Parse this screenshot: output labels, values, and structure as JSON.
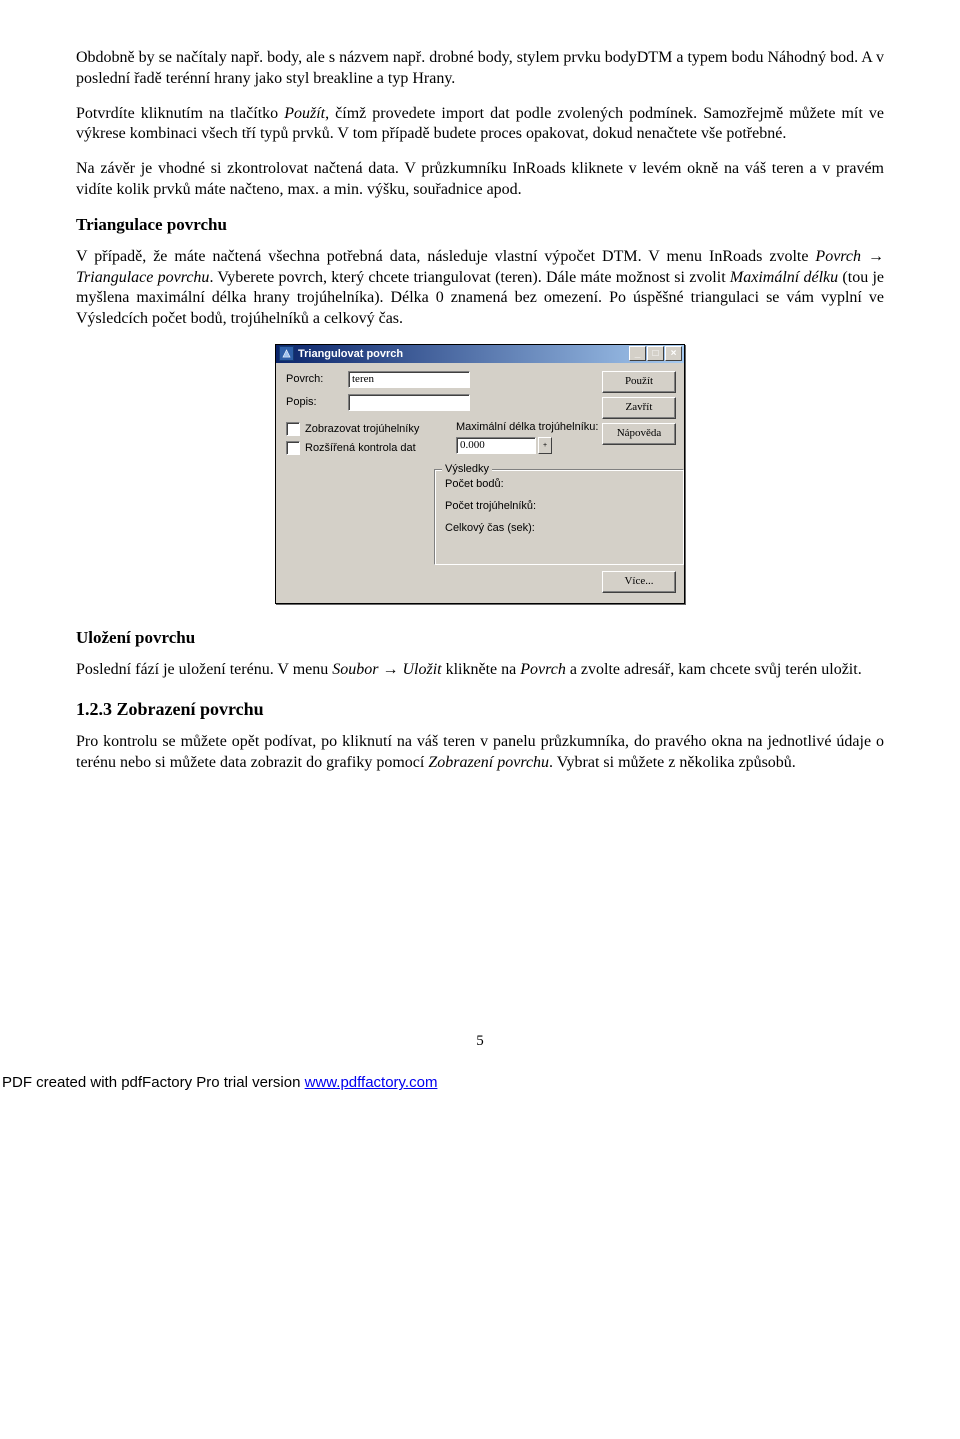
{
  "para1_a": "Obdobně by se načítaly např. body, ale s názvem např. drobné body, stylem prvku bodyDTM a typem bodu Náhodný bod. A v poslední řadě terénní hrany jako styl breakline a typ Hrany.",
  "para2_a": "Potvrdíte kliknutím na tlačítko ",
  "para2_i": "Použít",
  "para2_b": ", čímž provedete import dat podle zvolených podmínek. Samozřejmě můžete mít ve výkrese kombinaci všech tří typů prvků. V tom případě budete proces opakovat, dokud nenačtete vše potřebné.",
  "para3": "Na závěr je vhodné si zkontrolovat načtená data. V průzkumníku InRoads kliknete v levém okně na váš teren a v pravém vidíte kolik prvků máte načteno, max. a min. výšku, souřadnice apod.",
  "h_triang": "Triangulace povrchu",
  "para4_a": "V případě, že máte načtená všechna potřebná data, následuje vlastní výpočet DTM. V menu InRoads zvolte ",
  "para4_i1": "Povrch → Triangulace povrchu",
  "para4_b": ". Vyberete povrch, který chcete triangulovat (teren). Dále máte možnost si zvolit ",
  "para4_i2": "Maximální délku",
  "para4_c": " (tou je myšlena maximální délka hrany trojúhelníka). Délka 0 znamená bez omezení. Po úspěšné triangulaci se vám vyplní ve Výsledcích počet bodů, trojúhelníků a celkový čas.",
  "dialog": {
    "title": "Triangulovat povrch",
    "lbl_surface": "Povrch:",
    "val_surface": "teren",
    "lbl_desc": "Popis:",
    "chk1": "Zobrazovat trojúhelníky",
    "chk2": "Rozšířená kontrola dat",
    "lbl_maxlen": "Maximální délka trojúhelníku:",
    "val_maxlen": "0.000",
    "btn_use": "Použít",
    "btn_close": "Zavřít",
    "btn_help": "Nápověda",
    "fs_title": "Výsledky",
    "fs_points": "Počet bodů:",
    "fs_tri": "Počet trojúhelníků:",
    "fs_time": "Celkový čas (sek):",
    "btn_more": "Více..."
  },
  "h_save": "Uložení povrchu",
  "para5_a": "Poslední fází je uložení terénu. V menu ",
  "para5_i1": "Soubor → Uložit",
  "para5_b": " klikněte na ",
  "para5_i2": "Povrch",
  "para5_c": " a zvolte adresář, kam chcete svůj terén uložit.",
  "h_123": "1.2.3    Zobrazení povrchu",
  "para6_a": "Pro kontrolu se můžete opět podívat, po kliknutí na váš teren v panelu průzkumníka, do pravého okna na jednotlivé údaje o terénu nebo si můžete data zobrazit do grafiky pomocí ",
  "para6_i": "Zobrazení povrchu",
  "para6_b": ". Vybrat si můžete z několika způsobů.",
  "page_num": "5",
  "footer_a": "PDF created with pdfFactory Pro trial version ",
  "footer_link": "www.pdffactory.com"
}
